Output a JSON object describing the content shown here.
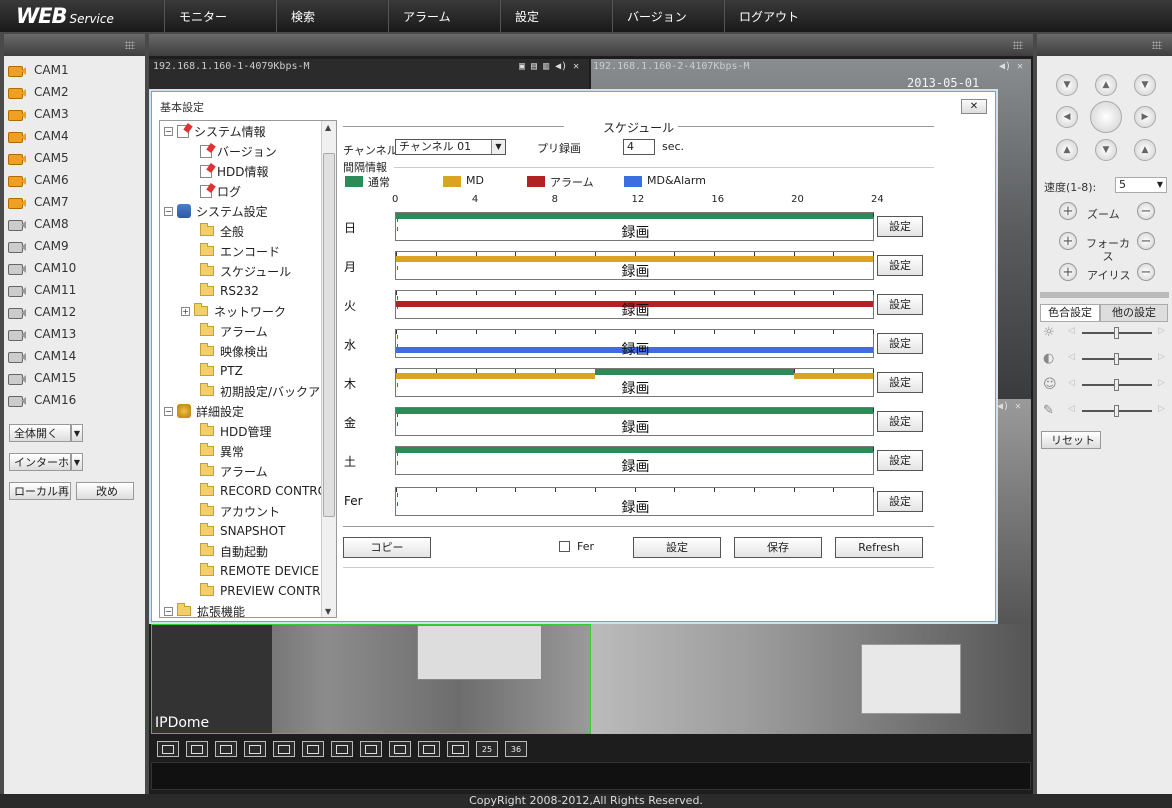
{
  "app": {
    "logo_main": "WEB",
    "logo_sub": "Service"
  },
  "nav": [
    "モニター",
    "検索",
    "アラーム",
    "設定",
    "バージョン",
    "ログアウト"
  ],
  "cameras": [
    {
      "label": "CAM1",
      "state": "on"
    },
    {
      "label": "CAM2",
      "state": "on"
    },
    {
      "label": "CAM3",
      "state": "on"
    },
    {
      "label": "CAM4",
      "state": "on"
    },
    {
      "label": "CAM5",
      "state": "on"
    },
    {
      "label": "CAM6",
      "state": "on"
    },
    {
      "label": "CAM7",
      "state": "on"
    },
    {
      "label": "CAM8",
      "state": "off"
    },
    {
      "label": "CAM9",
      "state": "off"
    },
    {
      "label": "CAM10",
      "state": "off"
    },
    {
      "label": "CAM11",
      "state": "off"
    },
    {
      "label": "CAM12",
      "state": "off"
    },
    {
      "label": "CAM13",
      "state": "off"
    },
    {
      "label": "CAM14",
      "state": "off"
    },
    {
      "label": "CAM15",
      "state": "off"
    },
    {
      "label": "CAM16",
      "state": "off"
    }
  ],
  "left_buttons": {
    "open_all": "全体開く",
    "intercom": "インターホ",
    "local_play": "ローカル再",
    "change": "改め"
  },
  "video": {
    "tile1_label": "192.168.1.160-1-4079Kbps-M",
    "tile2_label": "192.168.1.160-2-4107Kbps-M",
    "timestamp": "2013-05-01 16:21:14",
    "bottom_left_label": "IPDome",
    "layout_buttons": [
      "1",
      "1",
      "4",
      "1",
      "4",
      "6",
      "8",
      "9",
      "9",
      "16",
      "16",
      "25",
      "36"
    ]
  },
  "ptz": {
    "speed_label": "速度(1-8):",
    "speed_value": "5",
    "zoom_label": "ズーム",
    "focus_label": "フォーカス",
    "iris_label": "アイリス",
    "tab_color": "色合設定",
    "tab_other": "他の設定",
    "reset": "リセット"
  },
  "dialog": {
    "title": "基本設定",
    "close": "✕",
    "schedule_title": "スケジュール",
    "channel_label": "チャンネル",
    "channel_value": "チャンネル 01",
    "pre_record_label": "プリ録画",
    "pre_record_value": "4",
    "pre_record_unit": "sec.",
    "interval_label": "間隔情報",
    "legend": [
      {
        "label": "通常",
        "color": "#2e8b57"
      },
      {
        "label": "MD",
        "color": "#d9a520"
      },
      {
        "label": "アラーム",
        "color": "#b22222"
      },
      {
        "label": "MD&Alarm",
        "color": "#3b6fe0"
      }
    ],
    "ticks": [
      "0",
      "4",
      "8",
      "12",
      "16",
      "20",
      "24"
    ],
    "record_label": "録画",
    "set_label": "設定",
    "days": [
      {
        "label": "日",
        "segments": [
          {
            "start": 0,
            "end": 24,
            "type": "normal"
          }
        ]
      },
      {
        "label": "月",
        "segments": [
          {
            "start": 0,
            "end": 24,
            "type": "md"
          }
        ]
      },
      {
        "label": "火",
        "segments": [
          {
            "start": 0,
            "end": 24,
            "type": "alarm"
          }
        ]
      },
      {
        "label": "水",
        "segments": [
          {
            "start": 0,
            "end": 24,
            "type": "mdalarm"
          }
        ]
      },
      {
        "label": "木",
        "segments": [
          {
            "start": 0,
            "end": 10,
            "type": "md"
          },
          {
            "start": 10,
            "end": 20,
            "type": "normal"
          },
          {
            "start": 20,
            "end": 24,
            "type": "md"
          }
        ]
      },
      {
        "label": "金",
        "segments": [
          {
            "start": 0,
            "end": 24,
            "type": "normal"
          }
        ]
      },
      {
        "label": "土",
        "segments": [
          {
            "start": 0,
            "end": 24,
            "type": "normal"
          }
        ]
      },
      {
        "label": "Fer",
        "segments": []
      }
    ],
    "buttons": {
      "copy": "コピー",
      "fer": "Fer",
      "set": "設定",
      "save": "保存",
      "refresh": "Refresh"
    }
  },
  "tree": [
    {
      "label": "システム情報",
      "level": 0,
      "icon": "doc-icon",
      "expander": "−"
    },
    {
      "label": "バージョン",
      "level": 1,
      "icon": "doc-icon"
    },
    {
      "label": "HDD情報",
      "level": 1,
      "icon": "doc-icon"
    },
    {
      "label": "ログ",
      "level": 1,
      "icon": "doc-icon"
    },
    {
      "label": "システム設定",
      "level": 0,
      "icon": "settings-icon",
      "expander": "−"
    },
    {
      "label": "全般",
      "level": 1,
      "icon": "folder-icon"
    },
    {
      "label": "エンコード",
      "level": 1,
      "icon": "folder-icon"
    },
    {
      "label": "スケジュール",
      "level": 1,
      "icon": "folder-icon"
    },
    {
      "label": "RS232",
      "level": 1,
      "icon": "folder-icon"
    },
    {
      "label": "ネットワーク",
      "level": 1,
      "icon": "folder-icon",
      "expander": "+"
    },
    {
      "label": "アラーム",
      "level": 1,
      "icon": "folder-icon"
    },
    {
      "label": "映像検出",
      "level": 1,
      "icon": "folder-icon"
    },
    {
      "label": "PTZ",
      "level": 1,
      "icon": "folder-icon"
    },
    {
      "label": "初期設定/バックア",
      "level": 1,
      "icon": "folder-icon"
    },
    {
      "label": "詳細設定",
      "level": 0,
      "icon": "gears-icon",
      "expander": "−"
    },
    {
      "label": "HDD管理",
      "level": 1,
      "icon": "folder-icon"
    },
    {
      "label": "異常",
      "level": 1,
      "icon": "folder-icon"
    },
    {
      "label": "アラーム",
      "level": 1,
      "icon": "folder-icon"
    },
    {
      "label": "RECORD CONTRO",
      "level": 1,
      "icon": "folder-icon"
    },
    {
      "label": "アカウント",
      "level": 1,
      "icon": "folder-icon"
    },
    {
      "label": "SNAPSHOT",
      "level": 1,
      "icon": "folder-icon"
    },
    {
      "label": "自動起動",
      "level": 1,
      "icon": "folder-icon"
    },
    {
      "label": "REMOTE DEVICE",
      "level": 1,
      "icon": "folder-icon"
    },
    {
      "label": "PREVIEW CONTR",
      "level": 1,
      "icon": "folder-icon"
    },
    {
      "label": "拡張機能",
      "level": 0,
      "icon": "folder-icon",
      "expander": "−"
    }
  ],
  "footer": "CopyRight 2008-2012,All Rights Reserved."
}
